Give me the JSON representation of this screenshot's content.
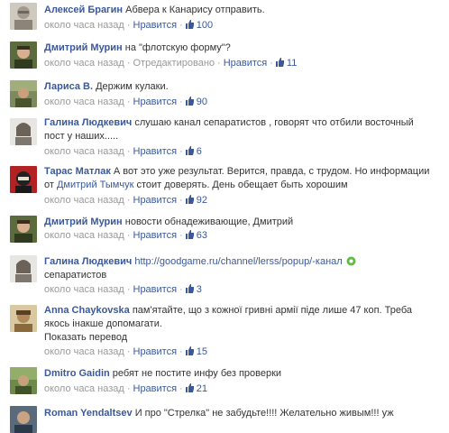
{
  "comments": [
    {
      "author": "Алексей Брагин",
      "text": "Абвера к Канарису отправить.",
      "time": "около часа назад",
      "edited": "",
      "like_label": "Нравится",
      "like_count": "100"
    },
    {
      "author": "Дмитрий Мурин",
      "text": "на \"флотскую форму\"?",
      "time": "около часа назад",
      "edited": "Отредактировано",
      "like_label": "Нравится",
      "like_count": "11"
    },
    {
      "author": "Лариса В.",
      "text": "Держим кулаки.",
      "time": "около часа назад",
      "edited": "",
      "like_label": "Нравится",
      "like_count": "90"
    },
    {
      "author": "Галина Людкевич",
      "text": "слушаю канал сепаратистов , говорят что отбили восточный пост у наших.....",
      "time": "около часа назад",
      "edited": "",
      "like_label": "Нравится",
      "like_count": "6"
    },
    {
      "author": "Тарас Матлак",
      "text_a": "А вот это уже результат. Верится, правда, с трудом. Но информации от",
      "text_link": "Дмитрий Тымчук",
      "text_b": "стоит доверять. День обещает быть хорошим",
      "time": "около часа назад",
      "edited": "",
      "like_label": "Нравится",
      "like_count": "92"
    },
    {
      "author": "Дмитрий Мурин",
      "text": "новости обнадеживающие, Дмитрий",
      "time": "около часа назад",
      "edited": "",
      "like_label": "Нравится",
      "like_count": "63"
    },
    {
      "author": "Галина Людкевич",
      "url": "http://goodgame.ru/channel/lerss/popup/-канал",
      "text": "сепаратистов",
      "time": "около часа назад",
      "edited": "",
      "like_label": "Нравится",
      "like_count": "3"
    },
    {
      "author": "Anna Chaykovska",
      "text": "пам'ятайте, що з кожної гривні армії піде лише 47 коп. Треба якось інакше допомагати.",
      "translate": "Показать перевод",
      "time": "около часа назад",
      "edited": "",
      "like_label": "Нравится",
      "like_count": "15"
    },
    {
      "author": "Dmitro Gaidin",
      "text": "ребят не постите инфу без проверки",
      "time": "около часа назад",
      "edited": "",
      "like_label": "Нравится",
      "like_count": "21"
    },
    {
      "author": "Roman Yendaltsev",
      "text": "И про \"Стрелка\" не забудьте!!!! Желательно живым!!! уж",
      "time": "",
      "edited": "",
      "like_label": "",
      "like_count": ""
    }
  ],
  "separator": "·",
  "icons": {
    "like": "thumbs-up-icon",
    "online": "online-status-icon"
  },
  "colors": {
    "link": "#3b5998",
    "meta": "#999999",
    "text": "#333333",
    "online": "#5fbf3c"
  }
}
